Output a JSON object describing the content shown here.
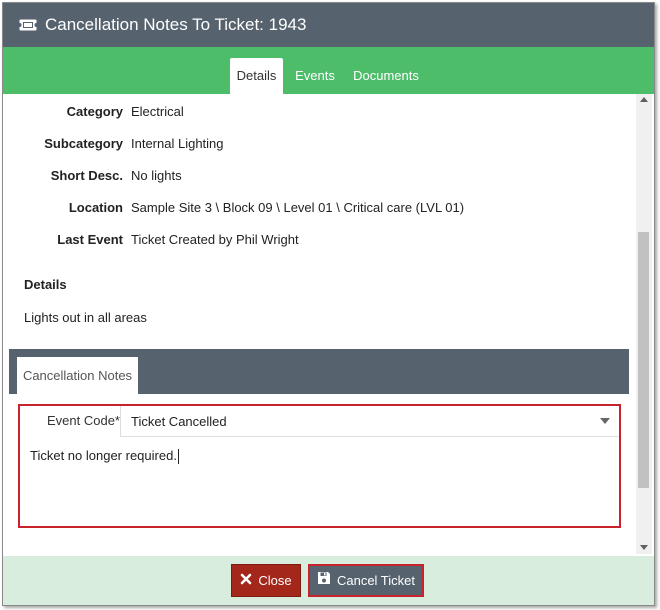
{
  "window": {
    "title": "Cancellation Notes To Ticket: 1943",
    "icon": "ticket-icon"
  },
  "tabs": [
    {
      "label": "Details",
      "active": true
    },
    {
      "label": "Events",
      "active": false
    },
    {
      "label": "Documents",
      "active": false
    }
  ],
  "fields": [
    {
      "label": "Category",
      "value": "Electrical"
    },
    {
      "label": "Subcategory",
      "value": "Internal Lighting"
    },
    {
      "label": "Short Desc.",
      "value": "No lights"
    },
    {
      "label": "Location",
      "value": "Sample Site 3 \\ Block 09 \\ Level 01 \\ Critical care (LVL 01)"
    },
    {
      "label": "Last Event",
      "value": "Ticket Created by Phil Wright"
    }
  ],
  "details": {
    "heading": "Details",
    "text": "Lights out in all areas"
  },
  "notes": {
    "tab_label": "Cancellation Notes",
    "event_code_label": "Event Code*",
    "event_code_value": "Ticket Cancelled",
    "notes_text": "Ticket no longer required."
  },
  "footer": {
    "close_label": "Close",
    "cancel_ticket_label": "Cancel Ticket"
  },
  "colors": {
    "titlebar": "#56626e",
    "tabbar": "#4ebd6a",
    "close_button": "#a3281b",
    "highlight_border": "#c8232c",
    "footer": "#d8eddd"
  }
}
